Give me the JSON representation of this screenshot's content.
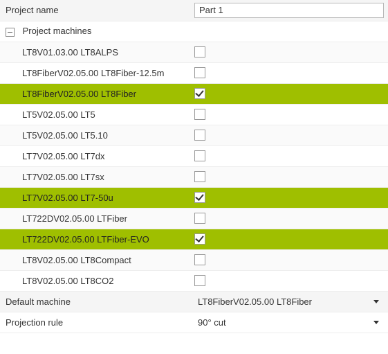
{
  "project_name": {
    "label": "Project name",
    "value": "Part 1"
  },
  "machines_group": {
    "label": "Project machines"
  },
  "machines": [
    {
      "label": "LT8V01.03.00 LT8ALPS",
      "checked": false,
      "selected": false
    },
    {
      "label": "LT8FiberV02.05.00 LT8Fiber-12.5m",
      "checked": false,
      "selected": false
    },
    {
      "label": "LT8FiberV02.05.00 LT8Fiber",
      "checked": true,
      "selected": true
    },
    {
      "label": "LT5V02.05.00 LT5",
      "checked": false,
      "selected": false
    },
    {
      "label": "LT5V02.05.00 LT5.10",
      "checked": false,
      "selected": false
    },
    {
      "label": "LT7V02.05.00 LT7dx",
      "checked": false,
      "selected": false
    },
    {
      "label": "LT7V02.05.00 LT7sx",
      "checked": false,
      "selected": false
    },
    {
      "label": "LT7V02.05.00 LT7-50u",
      "checked": true,
      "selected": true
    },
    {
      "label": "LT722DV02.05.00 LTFiber",
      "checked": false,
      "selected": false
    },
    {
      "label": "LT722DV02.05.00 LTFiber-EVO",
      "checked": true,
      "selected": true
    },
    {
      "label": "LT8V02.05.00 LT8Compact",
      "checked": false,
      "selected": false
    },
    {
      "label": "LT8V02.05.00 LT8CO2",
      "checked": false,
      "selected": false
    }
  ],
  "default_machine": {
    "label": "Default machine",
    "value": "LT8FiberV02.05.00 LT8Fiber"
  },
  "projection_rule": {
    "label": "Projection rule",
    "value": "90° cut"
  }
}
